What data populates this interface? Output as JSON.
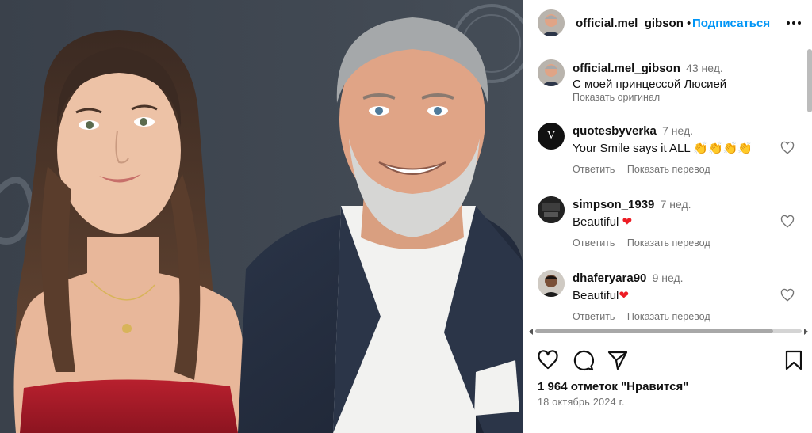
{
  "post": {
    "image_alt": "Фото: мужчина с седой бородой и девушка с длинными волосами на фоне стенда"
  },
  "header": {
    "username": "official.mel_gibson",
    "separator": "•",
    "follow_label": "Подписаться",
    "more_icon": "more-horizontal-icon"
  },
  "caption": {
    "username": "official.mel_gibson",
    "time": "43 нед.",
    "text": "С моей принцессой Люсией",
    "show_original": "Показать оригинал"
  },
  "comments": [
    {
      "username": "quotesbyverka",
      "avatar_letter": "V",
      "time": "7 нед.",
      "text": "Your Smile says it ALL",
      "emoji": "👏👏👏👏",
      "reply": "Ответить",
      "translate": "Показать перевод"
    },
    {
      "username": "simpson_1939",
      "time": "7 нед.",
      "text": "Beautiful",
      "emoji": "❤",
      "reply": "Ответить",
      "translate": "Показать перевод"
    },
    {
      "username": "dhaferyara90",
      "time": "9 нед.",
      "text": "Beautiful",
      "emoji": "❤",
      "reply": "Ответить",
      "translate": "Показать перевод"
    }
  ],
  "actions": {
    "like_icon": "heart-icon",
    "comment_icon": "comment-icon",
    "share_icon": "share-icon",
    "save_icon": "bookmark-icon",
    "likes_text": "1 964 отметок \"Нравится\"",
    "date_text": "18 октябрь 2024 г."
  },
  "colors": {
    "accent": "#0095f6",
    "heart": "#ed1c24",
    "muted": "#737373",
    "divider": "#dbdbdb"
  }
}
